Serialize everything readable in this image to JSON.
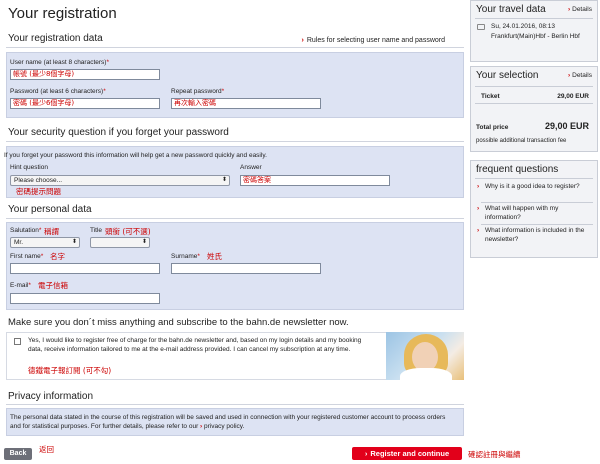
{
  "main": {
    "title": "Your registration",
    "reg_data": {
      "heading": "Your registration data",
      "rules_link": "Rules for selecting user name and password",
      "username_label": "User name (at least 8 characters)",
      "username_value": "帳號 (最少8個字母)",
      "password_label": "Password (at least 6 characters)",
      "password_value": "密碼 (最少6個字母)",
      "repeat_label": "Repeat password",
      "repeat_value": "再次輸入密碼"
    },
    "security": {
      "heading": "Your security question if you forget your password",
      "hint_text": "If you forget your password this information will help get a new password quickly and easily.",
      "question_label": "Hint question",
      "question_selected": "Please choose...",
      "question_annotation": "密碼提示問題",
      "answer_label": "Answer",
      "answer_value": "密碼答案"
    },
    "personal": {
      "heading": "Your personal data",
      "salutation_label": "Salutation",
      "salutation_annotation": "稱謂",
      "salutation_selected": "Mr.",
      "title_label": "Title",
      "title_annotation": "頭銜 (可不選)",
      "firstname_label": "First name",
      "firstname_annotation": "名字",
      "surname_label": "Surname",
      "surname_annotation": "姓氏",
      "email_label": "E-mail",
      "email_annotation": "電子信箱"
    },
    "newsletter": {
      "heading": "Make sure you don´t miss anything and subscribe to the bahn.de newsletter now.",
      "text": "Yes, I would like to register free of charge for the bahn.de newsletter and, based on my login details and my booking data, receive information tailored to me at the e-mail address provided. I can cancel my subscription at any time.",
      "annotation": "德鐵電子報訂閱 (可不勾)"
    },
    "privacy": {
      "heading": "Privacy information",
      "text_before": "The personal data stated in the course of this registration will be saved and used in connection with your registered customer account to process orders and for statistical purposes. For further details, please refer to our",
      "link": "privacy policy",
      "text_after": "."
    },
    "buttons": {
      "back": "Back",
      "back_annotation": "返回",
      "register": "Register and continue",
      "register_annotation": "確認註冊與繼續"
    }
  },
  "sidebar": {
    "travel": {
      "heading": "Your travel data",
      "details": "Details",
      "date": "Su, 24.01.2016, 08:13",
      "route": "Frankfurt(Main)Hbf - Berlin Hbf"
    },
    "selection": {
      "heading": "Your selection",
      "details": "Details",
      "ticket_label": "Ticket",
      "ticket_price": "29,00 EUR",
      "total_label": "Total price",
      "total_price": "29,00 EUR",
      "fee_note": "possible additional transaction fee"
    },
    "faq": {
      "heading": "frequent questions",
      "items": [
        "Why is it a good idea to register?",
        "What will happen with my information?",
        "What information is included in the newsletter?"
      ]
    }
  }
}
